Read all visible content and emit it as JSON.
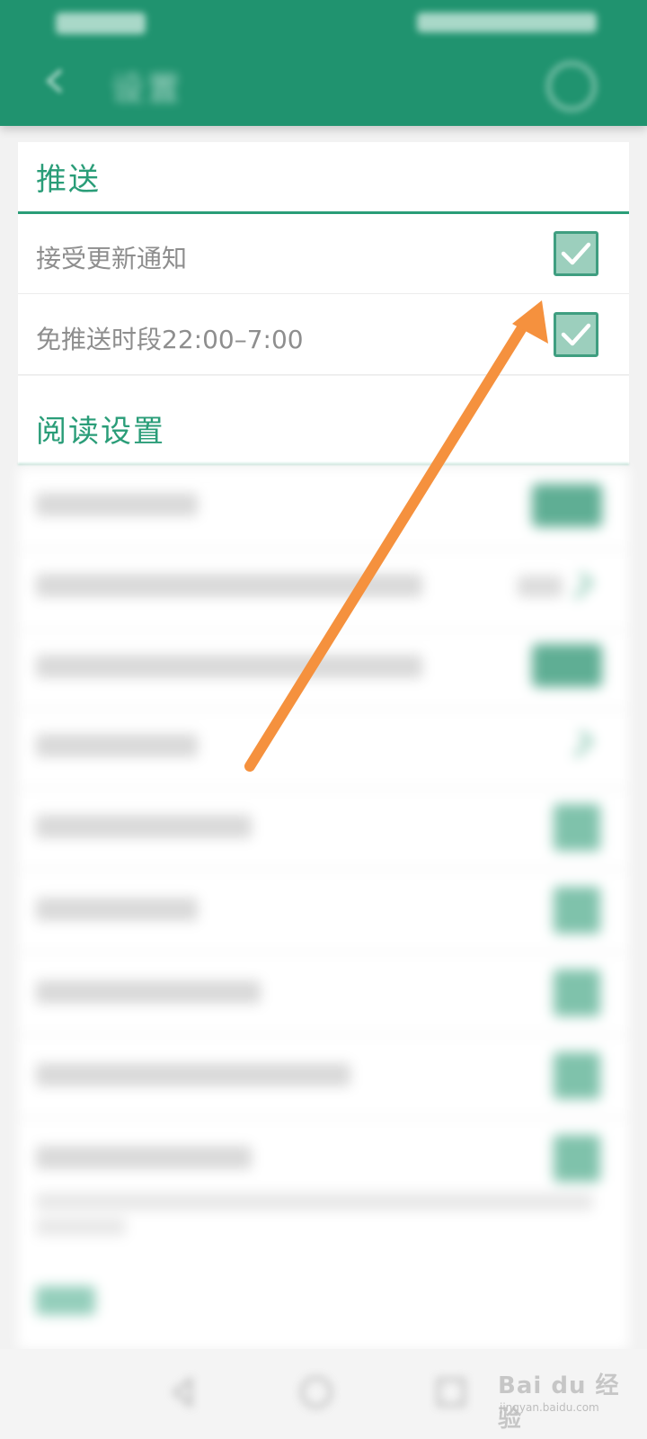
{
  "header": {
    "title": "设置"
  },
  "push": {
    "section_title": "推送",
    "items": [
      {
        "label": "接受更新通知",
        "checked": true
      },
      {
        "label": "免推送时段22:00–7:00",
        "checked": true
      }
    ]
  },
  "reading": {
    "section_title": "阅读设置"
  },
  "colors": {
    "accent": "#20936f",
    "section_title": "#2a9d78",
    "checkbox_fill": "#9ccfbd",
    "annotation_arrow": "#f5913e"
  },
  "watermark": {
    "brand": "Bai du 经验",
    "url": "jingyan.baidu.com"
  }
}
